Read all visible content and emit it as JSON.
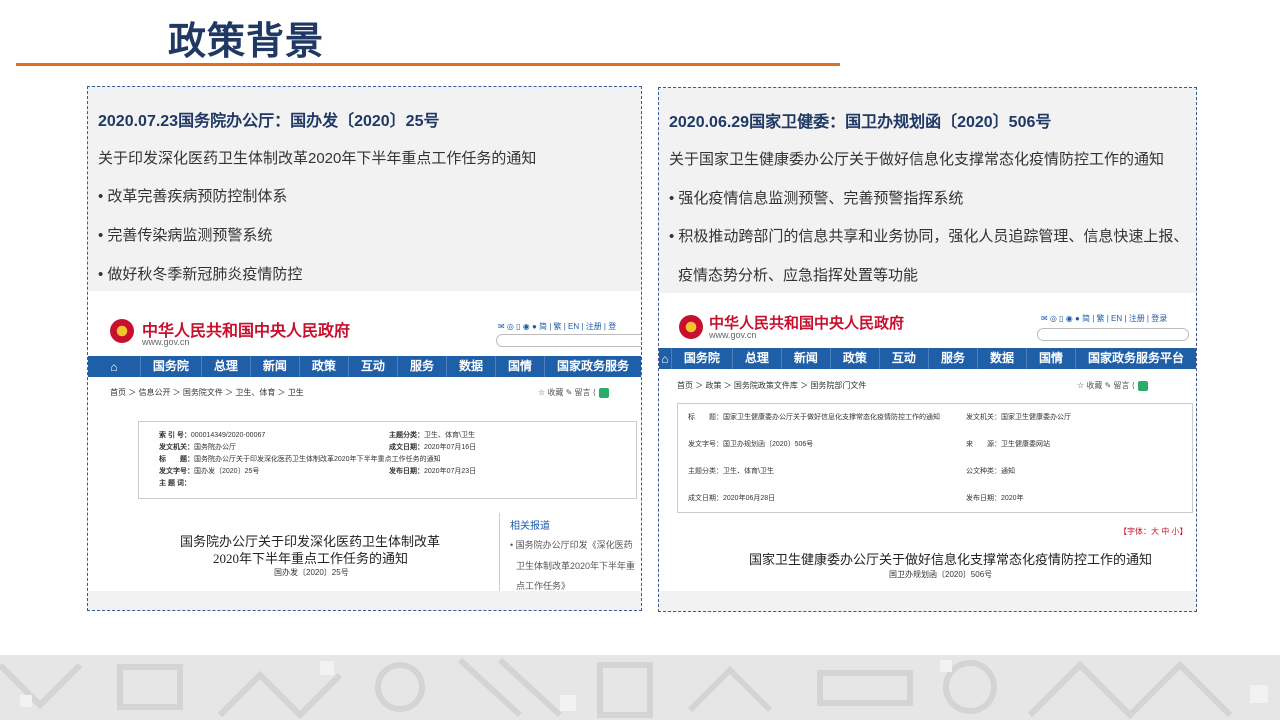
{
  "page_title": "政策背景",
  "panels": [
    {
      "heading": "2020.07.23国务院办公厅：国办发〔2020〕25号",
      "lines": [
        "关于印发深化医药卫生体制改革2020年下半年重点工作任务的通知",
        "• 改革完善疾病预防控制体系",
        "• 完善传染病监测预警系统",
        "• 做好秋冬季新冠肺炎疫情防控"
      ],
      "screenshot": {
        "site_name": "中华人民共和国中央人民政府",
        "site_url": "www.gov.cn",
        "top_links": "✉ ◎ ▯ ◉ ● 简 | 繁 | EN | 注册 | 登",
        "nav": [
          "国务院",
          "总理",
          "新闻",
          "政策",
          "互动",
          "服务",
          "数据",
          "国情",
          "国家政务服务"
        ],
        "breadcrumb": "首页 ＞ 信息公开 ＞ 国务院文件 ＞ 卫生、体育 ＞ 卫生",
        "tools": "☆ 收藏   ✎ 留言   ⟨",
        "meta": [
          {
            "label": "索 引 号：",
            "value": "000014349/2020-00067",
            "label2": "主题分类：",
            "value2": "卫生、体育\\卫生"
          },
          {
            "label": "发文机关：",
            "value": "国务院办公厅",
            "label2": "成文日期：",
            "value2": "2020年07月16日"
          },
          {
            "label": "标　　题：",
            "value": "国务院办公厅关于印发深化医药卫生体制改革2020年下半年重点工作任务的通知",
            "label2": "",
            "value2": ""
          },
          {
            "label": "发文字号：",
            "value": "国办发〔2020〕25号",
            "label2": "发布日期：",
            "value2": "2020年07月23日"
          },
          {
            "label": "主 题 词：",
            "value": "",
            "label2": "",
            "value2": ""
          }
        ],
        "doc_title_1": "国务院办公厅关于印发深化医药卫生体制改革",
        "doc_title_2": "2020年下半年重点工作任务的通知",
        "doc_number": "国办发〔2020〕25号",
        "related_title": "相关报道",
        "related_lines": [
          "• 国务院办公厅印发《深化医药",
          "卫生体制改革2020年下半年重",
          "点工作任务》"
        ]
      }
    },
    {
      "heading": "2020.06.29国家卫健委：国卫办规划函〔2020〕506号",
      "lines": [
        "关于国家卫生健康委办公厅关于做好信息化支撑常态化疫情防控工作的通知",
        "• 强化疫情信息监测预警、完善预警指挥系统",
        "• 积极推动跨部门的信息共享和业务协同，强化人员追踪管理、信息快速上报、",
        "疫情态势分析、应急指挥处置等功能"
      ],
      "screenshot": {
        "site_name": "中华人民共和国中央人民政府",
        "site_url": "www.gov.cn",
        "top_links": "✉ ◎ ▯ ◉ ● 简 | 繁 | EN | 注册 | 登录",
        "nav": [
          "国务院",
          "总理",
          "新闻",
          "政策",
          "互动",
          "服务",
          "数据",
          "国情",
          "国家政务服务平台"
        ],
        "breadcrumb": "首页 ＞ 政策 ＞ 国务院政策文件库 ＞ 国务院部门文件",
        "tools": "☆ 收藏   ✎ 留言   ⟨",
        "meta": [
          {
            "label": "标　　题：",
            "value": "国家卫生健康委办公厅关于做好信息化支撑常态化疫情防控工作的通知",
            "label2": "发文机关：",
            "value2": "国家卫生健康委办公厅"
          },
          {
            "label": "发文字号：",
            "value": "国卫办规划函〔2020〕506号",
            "label2": "来　　源：",
            "value2": "卫生健康委网站"
          },
          {
            "label": "主题分类：",
            "value": "卫生、体育\\卫生",
            "label2": "公文种类：",
            "value2": "通知"
          },
          {
            "label": "成文日期：",
            "value": "2020年06月28日",
            "label2": "发布日期：",
            "value2": "2020年"
          }
        ],
        "font_size_label": "【字体：大 中 小】",
        "doc_title_1": "国家卫生健康委办公厅关于做好信息化支撑常态化疫情防控工作的通知",
        "doc_number": "国卫办规划函〔2020〕506号"
      }
    }
  ],
  "colors": {
    "title": "#1f3864",
    "rule": "#e07020",
    "nav": "#1f5fa8",
    "site_red": "#c8102e"
  }
}
